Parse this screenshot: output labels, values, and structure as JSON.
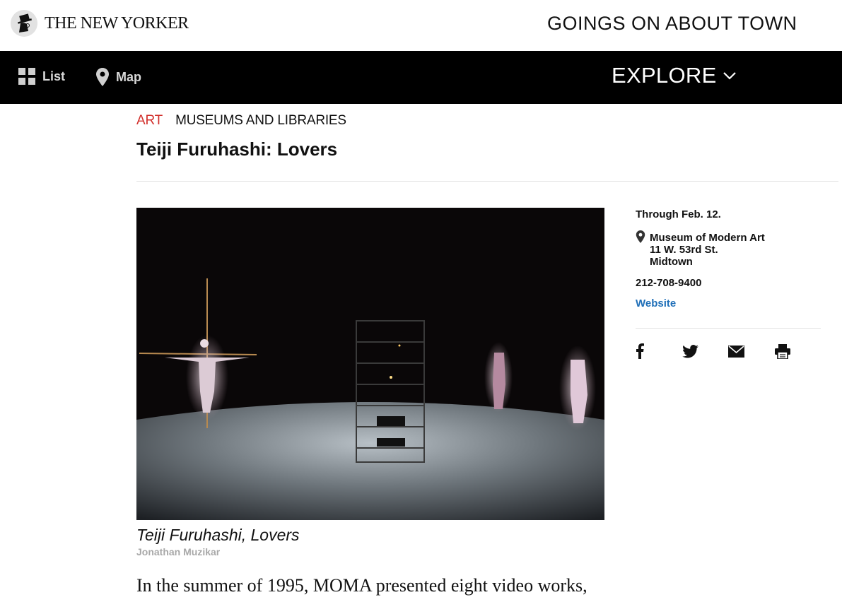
{
  "brand": {
    "logo_text": "THE NEW YORKER"
  },
  "header": {
    "section_title": "GOINGS ON ABOUT TOWN"
  },
  "nav": {
    "list_label": "List",
    "map_label": "Map",
    "explore_label": "EXPLORE"
  },
  "breadcrumb": {
    "category": "ART",
    "subcategory": "MUSEUMS AND LIBRARIES"
  },
  "article": {
    "title": "Teiji Furuhashi: Lovers",
    "image_caption": "Teiji Furuhashi, Lovers",
    "image_credit": "Jonathan Muzikar",
    "lede": "In the summer of 1995, MOMA presented eight video works,"
  },
  "details": {
    "dates": "Through Feb. 12.",
    "venue_name": "Museum of Modern Art",
    "address_line": "11 W. 53rd St.",
    "neighborhood": "Midtown",
    "phone": "212-708-9400",
    "website_label": "Website"
  },
  "share": {
    "icons": [
      "facebook-icon",
      "twitter-icon",
      "email-icon",
      "print-icon"
    ]
  },
  "colors": {
    "category_red": "#d2302c",
    "link_blue": "#1f6fb8",
    "nav_black": "#000000"
  }
}
